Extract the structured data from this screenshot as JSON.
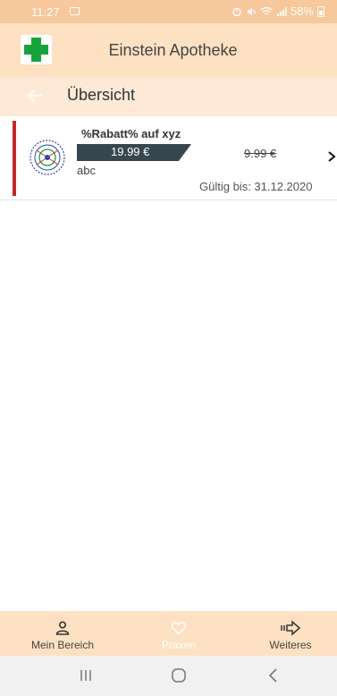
{
  "status_bar": {
    "time": "11:27",
    "battery": "58%"
  },
  "header": {
    "title": "Einstein Apotheke"
  },
  "sub_header": {
    "title": "Übersicht"
  },
  "offer": {
    "title": "%Rabatt% auf xyz",
    "price": "19.99 €",
    "old_price": "9.99 €",
    "description": "abc",
    "valid_until": "Gültig bis: 31.12.2020"
  },
  "bottom_nav": {
    "items": [
      {
        "label": "Mein Bereich",
        "icon": "person-icon"
      },
      {
        "label": "Praxen",
        "icon": "heart-icon"
      },
      {
        "label": "Weiteres",
        "icon": "forward-arrow-icon"
      }
    ]
  },
  "colors": {
    "status_bar": "#f7c89b",
    "header": "#fde1c2",
    "sub_header": "#fde9d6",
    "accent_green": "#17a33b",
    "offer_bar": "#37474f",
    "red_marker": "#c62828"
  }
}
